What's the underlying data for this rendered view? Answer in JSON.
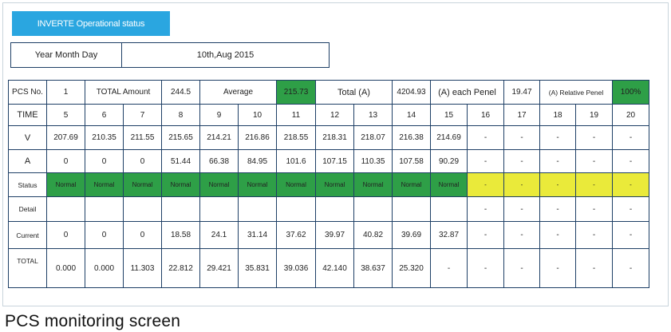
{
  "header": {
    "tab_label": "INVERTE Operational status",
    "date_label": "Year Month Day",
    "date_value": "10th,Aug 2015"
  },
  "summary": {
    "pcs_label": "PCS No.",
    "pcs_value": "1",
    "total_amount_label": "TOTAL Amount",
    "total_amount_value": "244.5",
    "average_label": "Average",
    "average_value": "215.73",
    "total_a_label": "Total (A)",
    "total_a_value": "4204.93",
    "each_panel_label": "(A) each Penel",
    "each_panel_value": "19.47",
    "relative_label": "(A) Relative Penel",
    "relative_value": "100%"
  },
  "rows": {
    "time": {
      "label": "TIME",
      "values": [
        "5",
        "6",
        "7",
        "8",
        "9",
        "10",
        "11",
        "12",
        "13",
        "14",
        "15",
        "16",
        "17",
        "18",
        "19",
        "20"
      ]
    },
    "v": {
      "label": "V",
      "values": [
        "207.69",
        "210.35",
        "211.55",
        "215.65",
        "214.21",
        "216.86",
        "218.55",
        "218.31",
        "218.07",
        "216.38",
        "214.69",
        "-",
        "-",
        "-",
        "-",
        "-"
      ]
    },
    "a": {
      "label": "A",
      "values": [
        "0",
        "0",
        "0",
        "51.44",
        "66.38",
        "84.95",
        "101.6",
        "107.15",
        "110.35",
        "107.58",
        "90.29",
        "-",
        "-",
        "-",
        "-",
        "-"
      ]
    },
    "status": {
      "label": "Status",
      "values": [
        "Normal",
        "Normal",
        "Normal",
        "Normal",
        "Normal",
        "Normal",
        "Normal",
        "Normal",
        "Normal",
        "Normal",
        "Normal",
        "-",
        "-",
        "-",
        "-",
        "-"
      ]
    },
    "detail": {
      "label": "Detail",
      "values": [
        "",
        "",
        "",
        "",
        "",
        "",
        "",
        "",
        "",
        "",
        "",
        "-",
        "-",
        "-",
        "-",
        "-"
      ]
    },
    "current": {
      "label": "Current",
      "values": [
        "0",
        "0",
        "0",
        "18.58",
        "24.1",
        "31.14",
        "37.62",
        "39.97",
        "40.82",
        "39.69",
        "32.87",
        "-",
        "-",
        "-",
        "-",
        "-"
      ]
    },
    "total": {
      "label": "TOTAL",
      "values": [
        "0.000",
        "0.000",
        "11.303",
        "22.812",
        "29.421",
        "35.831",
        "39.036",
        "42.140",
        "38.637",
        "25.320",
        "-",
        "-",
        "-",
        "-",
        "-",
        "-"
      ]
    }
  },
  "caption": "PCS monitoring screen",
  "colors": {
    "tab": "#2aa6e0",
    "normal": "#2e9f47",
    "inactive": "#eaea3a",
    "border": "#1e3f66"
  }
}
